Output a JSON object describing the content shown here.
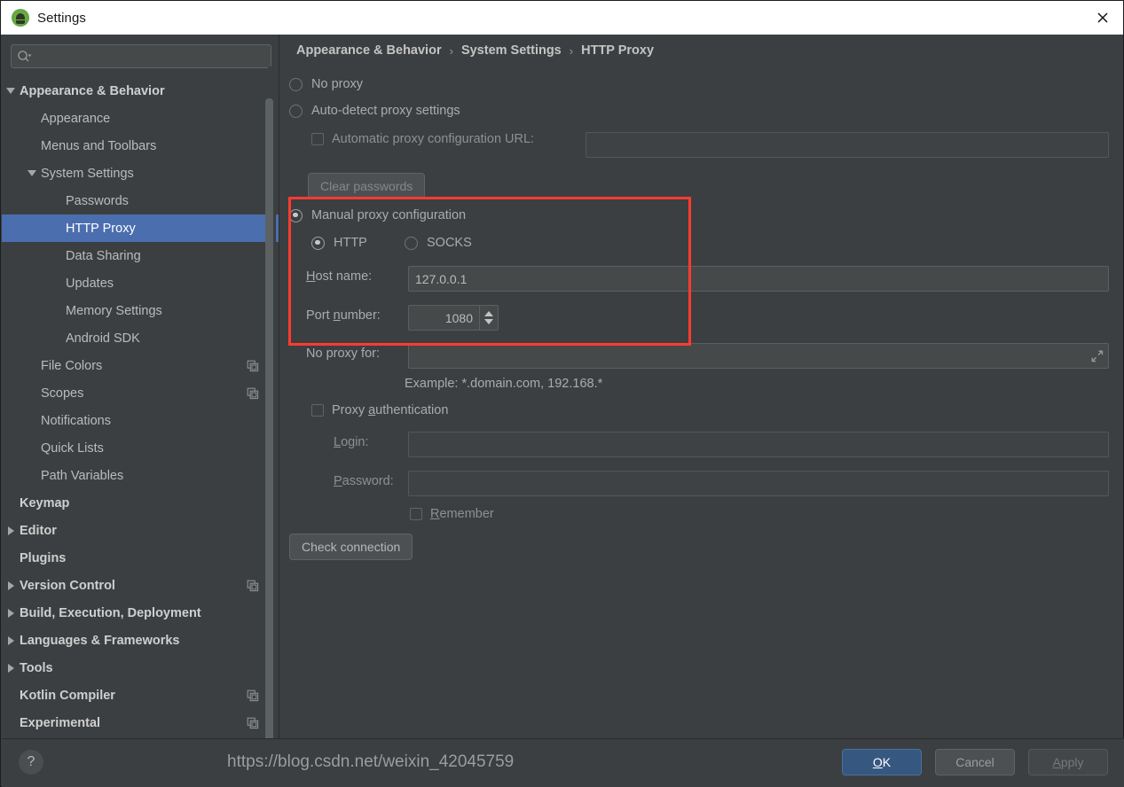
{
  "window": {
    "title": "Settings",
    "app_icon": "android-studio-icon",
    "close_icon": "close-icon"
  },
  "sidebar": {
    "search": {
      "placeholder": "",
      "value": "",
      "icon": "search-icon"
    },
    "items": [
      {
        "label": "Appearance & Behavior",
        "indent": 0,
        "twisty": "down",
        "bold": true,
        "selected": false,
        "copy": false
      },
      {
        "label": "Appearance",
        "indent": 1,
        "twisty": "none",
        "bold": false,
        "selected": false,
        "copy": false
      },
      {
        "label": "Menus and Toolbars",
        "indent": 1,
        "twisty": "none",
        "bold": false,
        "selected": false,
        "copy": false
      },
      {
        "label": "System Settings",
        "indent": 1,
        "twisty": "down",
        "bold": false,
        "selected": false,
        "copy": false
      },
      {
        "label": "Passwords",
        "indent": 2,
        "twisty": "none",
        "bold": false,
        "selected": false,
        "copy": false
      },
      {
        "label": "HTTP Proxy",
        "indent": 2,
        "twisty": "none",
        "bold": false,
        "selected": true,
        "copy": false
      },
      {
        "label": "Data Sharing",
        "indent": 2,
        "twisty": "none",
        "bold": false,
        "selected": false,
        "copy": false
      },
      {
        "label": "Updates",
        "indent": 2,
        "twisty": "none",
        "bold": false,
        "selected": false,
        "copy": false
      },
      {
        "label": "Memory Settings",
        "indent": 2,
        "twisty": "none",
        "bold": false,
        "selected": false,
        "copy": false
      },
      {
        "label": "Android SDK",
        "indent": 2,
        "twisty": "none",
        "bold": false,
        "selected": false,
        "copy": false
      },
      {
        "label": "File Colors",
        "indent": 1,
        "twisty": "none",
        "bold": false,
        "selected": false,
        "copy": true
      },
      {
        "label": "Scopes",
        "indent": 1,
        "twisty": "none",
        "bold": false,
        "selected": false,
        "copy": true
      },
      {
        "label": "Notifications",
        "indent": 1,
        "twisty": "none",
        "bold": false,
        "selected": false,
        "copy": false
      },
      {
        "label": "Quick Lists",
        "indent": 1,
        "twisty": "none",
        "bold": false,
        "selected": false,
        "copy": false
      },
      {
        "label": "Path Variables",
        "indent": 1,
        "twisty": "none",
        "bold": false,
        "selected": false,
        "copy": false
      },
      {
        "label": "Keymap",
        "indent": 0,
        "twisty": "none",
        "bold": true,
        "selected": false,
        "copy": false
      },
      {
        "label": "Editor",
        "indent": 0,
        "twisty": "right",
        "bold": true,
        "selected": false,
        "copy": false
      },
      {
        "label": "Plugins",
        "indent": 0,
        "twisty": "none",
        "bold": true,
        "selected": false,
        "copy": false
      },
      {
        "label": "Version Control",
        "indent": 0,
        "twisty": "right",
        "bold": true,
        "selected": false,
        "copy": true
      },
      {
        "label": "Build, Execution, Deployment",
        "indent": 0,
        "twisty": "right",
        "bold": true,
        "selected": false,
        "copy": false
      },
      {
        "label": "Languages & Frameworks",
        "indent": 0,
        "twisty": "right",
        "bold": true,
        "selected": false,
        "copy": false
      },
      {
        "label": "Tools",
        "indent": 0,
        "twisty": "right",
        "bold": true,
        "selected": false,
        "copy": false
      },
      {
        "label": "Kotlin Compiler",
        "indent": 0,
        "twisty": "none",
        "bold": true,
        "selected": false,
        "copy": true
      },
      {
        "label": "Experimental",
        "indent": 0,
        "twisty": "none",
        "bold": true,
        "selected": false,
        "copy": true
      }
    ]
  },
  "breadcrumb": {
    "part1": "Appearance & Behavior",
    "sep1": "›",
    "part2": "System Settings",
    "sep2": "›",
    "part3": "HTTP Proxy"
  },
  "form": {
    "no_proxy": {
      "label": "No proxy",
      "checked": false
    },
    "auto_detect": {
      "label": "Auto-detect proxy settings",
      "checked": false
    },
    "auto_config_url": {
      "label": "Automatic proxy configuration URL:",
      "checked": false,
      "value": "",
      "placeholder": ""
    },
    "clear_passwords": {
      "label": "Clear passwords"
    },
    "manual": {
      "label": "Manual proxy configuration",
      "checked": true
    },
    "protocol_http": {
      "label": "HTTP",
      "checked": true
    },
    "protocol_socks": {
      "label": "SOCKS",
      "checked": false
    },
    "host_name": {
      "label_pre": "H",
      "label_post": "ost name:",
      "value": "127.0.0.1",
      "placeholder": ""
    },
    "port_number": {
      "label_pre": "Port ",
      "label_u": "n",
      "label_post": "umber:",
      "value": "1080"
    },
    "no_proxy_for": {
      "label": "No proxy for:",
      "value": "",
      "placeholder": "",
      "expand_icon": "expand-icon"
    },
    "example_hint": "Example: *.domain.com, 192.168.*",
    "proxy_auth": {
      "label_pre": "Proxy ",
      "label_u": "a",
      "label_post": "uthentication",
      "checked": false
    },
    "login": {
      "label_u": "L",
      "label_post": "ogin:",
      "value": "",
      "placeholder": ""
    },
    "password": {
      "label_u": "P",
      "label_post": "assword:",
      "value": "",
      "placeholder": ""
    },
    "remember": {
      "label_u": "R",
      "label_post": "emember",
      "checked": false
    },
    "check_connection": {
      "label": "Check connection"
    }
  },
  "footer": {
    "help": "?",
    "ok_pre": "O",
    "ok_post": "K",
    "cancel_pre": "C",
    "cancel_post": "ancel",
    "apply_pre": "A",
    "apply_post": "pply"
  },
  "overlay": {
    "watermark": "https://blog.csdn.net/weixin_42045759",
    "highlight_color": "#ff3b30"
  }
}
